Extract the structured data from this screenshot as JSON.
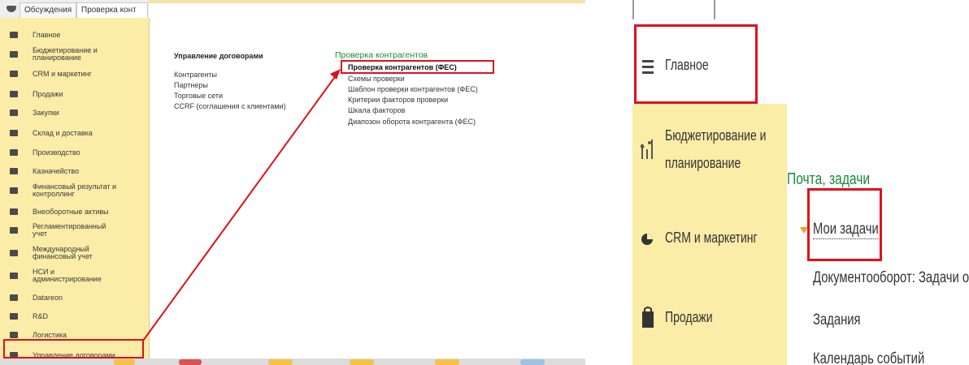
{
  "tabs": [
    "Обсуждения",
    "Проверка конт"
  ],
  "sidebar": {
    "items": [
      {
        "label": "Главное",
        "icon": "menu-icon"
      },
      {
        "label": "Бюджетирование и\nпланирование",
        "icon": "budget-icon"
      },
      {
        "label": "CRM и маркетинг",
        "icon": "crm-icon"
      },
      {
        "label": "Продажи",
        "icon": "sales-icon"
      },
      {
        "label": "Закупки",
        "icon": "cart-icon"
      },
      {
        "label": "Склад и доставка",
        "icon": "warehouse-icon"
      },
      {
        "label": "Производство",
        "icon": "factory-icon"
      },
      {
        "label": "Казначейство",
        "icon": "treasury-icon"
      },
      {
        "label": "Финансовый результат и\nконтроллинг",
        "icon": "chart-icon"
      },
      {
        "label": "Внеоборотные активы",
        "icon": "assets-icon"
      },
      {
        "label": "Регламентированный\nучет",
        "icon": "ledger-icon"
      },
      {
        "label": "Международный\nфинансовый учет",
        "icon": "ifrs-icon"
      },
      {
        "label": "НСИ и\nадминистрирование",
        "icon": "gear-icon"
      },
      {
        "label": "Datareon",
        "icon": "datareon-icon"
      },
      {
        "label": "R&D",
        "icon": "rnd-icon"
      },
      {
        "label": "Логистика",
        "icon": "truck-icon"
      },
      {
        "label": "Управление договорами",
        "icon": "contracts-icon"
      }
    ]
  },
  "content": {
    "contracts_section": {
      "title": "Управление договорами",
      "links": [
        "Контрагенты",
        "Партнеры",
        "Торговые сети",
        "CCRF (соглашения с клиентами)"
      ]
    },
    "check_section": {
      "title": "Проверка контрагентов",
      "links": [
        "Проверка контрагентов (ФЕС)",
        "Схемы проверки",
        "Шаблон проверки контрагентов (ФЕС)",
        "Критерии факторов проверки",
        "Шкала факторов",
        "Диапозон оборота контрагента (ФЕС)"
      ]
    }
  },
  "zoom": {
    "sidebar_items": [
      "Главное",
      "Бюджетирование и\nпланирование",
      "CRM и маркетинг",
      "Продажи"
    ],
    "section_title": "Почта, задачи",
    "links": [
      "Мои задачи",
      "Документооборот: Задачи от меня",
      "Задания",
      "Календарь событий"
    ]
  },
  "colors": {
    "sidebar_bg": "#fbeca7",
    "highlight": "#e0101a",
    "section_green": "#1a8a3a"
  }
}
